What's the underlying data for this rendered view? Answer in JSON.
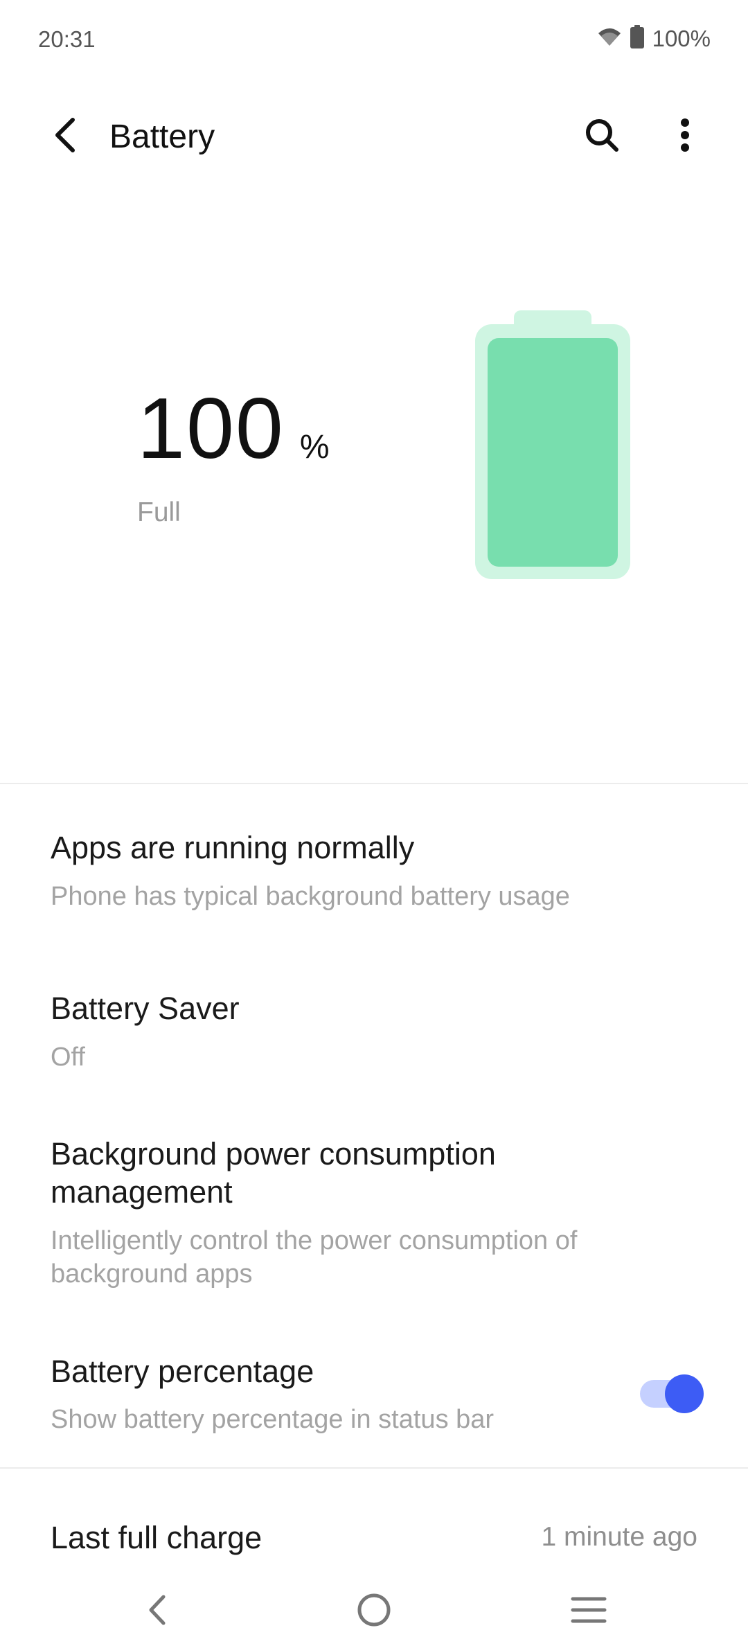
{
  "status_bar": {
    "time": "20:31",
    "battery_percent": "100%",
    "icons": [
      "wifi-icon",
      "battery-icon"
    ]
  },
  "app_bar": {
    "title": "Battery",
    "icons": [
      "back-arrow-icon",
      "search-icon",
      "more-vert-icon"
    ]
  },
  "battery": {
    "level_number": "100",
    "level_unit": "%",
    "state": "Full",
    "level_fraction": 1.0,
    "colors": {
      "outer": "#cff5e2",
      "inner": "#78deae"
    }
  },
  "settings": [
    {
      "title": "Apps are running normally",
      "subtitle": "Phone has typical background battery usage"
    },
    {
      "title": "Battery Saver",
      "subtitle": "Off"
    },
    {
      "title_line1": "Background power consumption",
      "title_line2": "management",
      "subtitle_line1": "Intelligently control the power consumption of",
      "subtitle_line2": "background apps"
    },
    {
      "title": "Battery percentage",
      "subtitle": "Show battery percentage in status bar",
      "toggle_on": true
    }
  ],
  "last_charge": {
    "label": "Last full charge",
    "value": "1 minute ago"
  },
  "nav_bar": {
    "icons": [
      "nav-back-icon",
      "nav-home-icon",
      "nav-recents-icon"
    ]
  },
  "colors": {
    "accent": "#3d5cf5",
    "toggle_track": "#c5d0ff",
    "secondary_text": "#a3a3a3"
  }
}
